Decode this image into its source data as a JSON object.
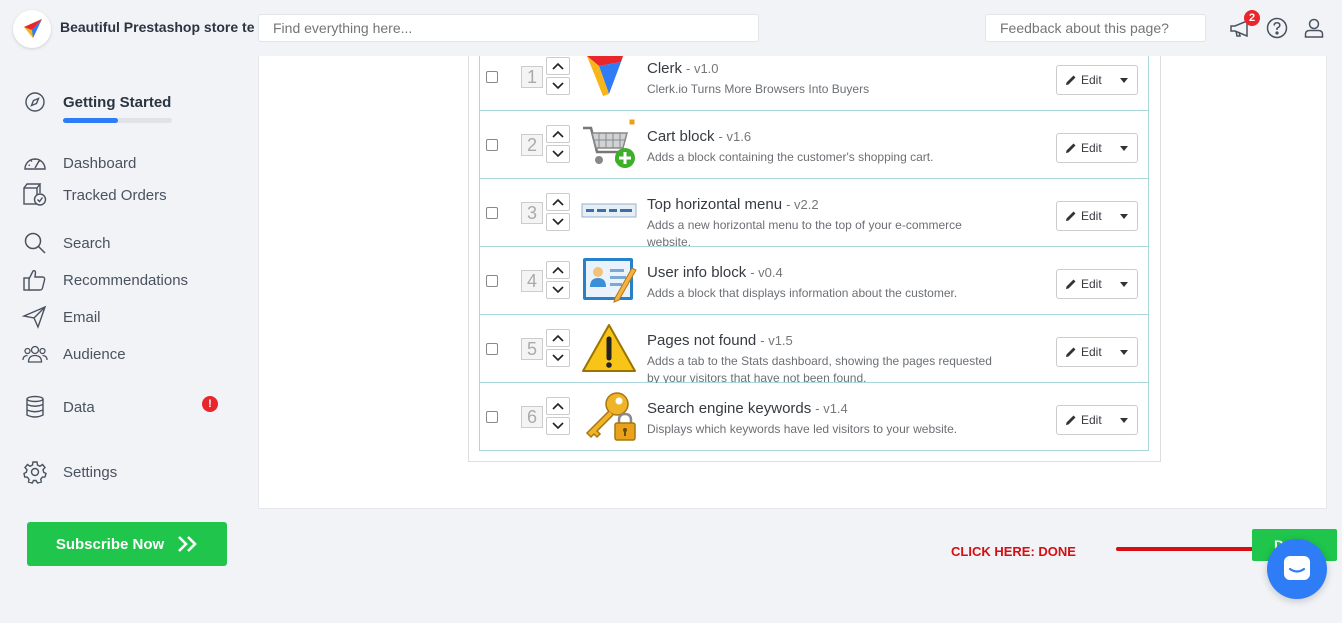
{
  "header": {
    "store_name": "Beautiful Prestashop store te",
    "search_placeholder": "Find everything here...",
    "feedback_placeholder": "Feedback about this page?",
    "notification_count": "2"
  },
  "sidebar": {
    "items": [
      {
        "label": "Getting Started",
        "icon": "compass-icon",
        "active": true
      },
      {
        "label": "Dashboard",
        "icon": "gauge-icon"
      },
      {
        "label": "Tracked Orders",
        "icon": "tracked-orders-icon"
      },
      {
        "label": "Search",
        "icon": "search-icon"
      },
      {
        "label": "Recommendations",
        "icon": "thumbs-up-icon"
      },
      {
        "label": "Email",
        "icon": "paper-plane-icon"
      },
      {
        "label": "Audience",
        "icon": "users-icon"
      },
      {
        "label": "Data",
        "icon": "database-icon"
      },
      {
        "label": "Settings",
        "icon": "gear-icon"
      }
    ],
    "getting_started_progress": 0.5,
    "data_alert": "!",
    "subscribe_label": "Subscribe Now"
  },
  "modules": [
    {
      "position": "1",
      "title": "Clerk",
      "version": "- v1.0",
      "description": "Clerk.io Turns More Browsers Into Buyers",
      "icon": "clerk-logo-icon"
    },
    {
      "position": "2",
      "title": "Cart block",
      "version": "- v1.6",
      "description": "Adds a block containing the customer's shopping cart.",
      "icon": "cart-add-icon"
    },
    {
      "position": "3",
      "title": "Top horizontal menu",
      "version": "- v2.2",
      "description": "Adds a new horizontal menu to the top of your e-commerce website.",
      "icon": "horizontal-menu-icon"
    },
    {
      "position": "4",
      "title": "User info block",
      "version": "- v0.4",
      "description": "Adds a block that displays information about the customer.",
      "icon": "user-card-icon"
    },
    {
      "position": "5",
      "title": "Pages not found",
      "version": "- v1.5",
      "description": "Adds a tab to the Stats dashboard, showing the pages requested by your visitors that have not been found.",
      "icon": "warning-icon"
    },
    {
      "position": "6",
      "title": "Search engine keywords",
      "version": "- v1.4",
      "description": "Displays which keywords have led visitors to your website.",
      "icon": "key-lock-icon"
    }
  ],
  "edit_label": "Edit",
  "annotation": {
    "click_here": "CLICK HERE: DONE",
    "done_label": "D"
  },
  "colors": {
    "accent_green": "#1fc64b",
    "accent_blue": "#2e7cf6",
    "alert_red": "#e8262b",
    "annotation_red": "#d60d12"
  }
}
